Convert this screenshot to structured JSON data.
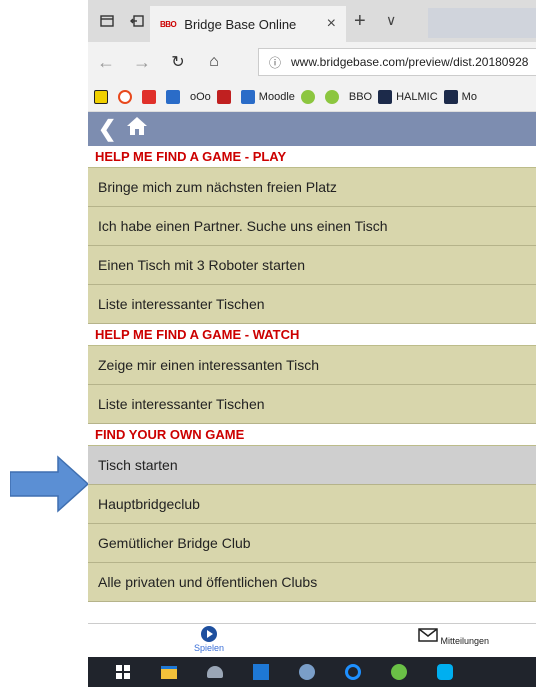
{
  "browser": {
    "tab_title": "Bridge Base Online",
    "tab_favicon": "BBO",
    "tab_close": "×",
    "new_tab": "+",
    "tab_menu": "∨",
    "url": "www.bridgebase.com/preview/dist.20180928",
    "nav_back": "←",
    "nav_forward": "→",
    "nav_refresh": "↻",
    "nav_home": "⌂",
    "url_info": "ⓘ"
  },
  "favorites": [
    {
      "label": "",
      "color": "#f0d000",
      "icon": "x-icon"
    },
    {
      "label": "",
      "color": "#e8491d",
      "icon": "app-icon"
    },
    {
      "label": "",
      "color": "#e0302a",
      "icon": "app-icon"
    },
    {
      "label": "",
      "color": "#2a6cc8",
      "icon": "app-icon"
    },
    {
      "label": "oOo",
      "color": "",
      "icon": ""
    },
    {
      "label": "",
      "color": "#c02020",
      "icon": "bmf-icon"
    },
    {
      "label": "Moodle",
      "color": "#2a6cc8",
      "icon": "moodle-icon"
    },
    {
      "label": "",
      "color": "#8cc63f",
      "icon": "circle-icon"
    },
    {
      "label": "",
      "color": "#8cc63f",
      "icon": "circle-icon"
    },
    {
      "label": "BBO",
      "color": "",
      "icon": "bbo-icon"
    },
    {
      "label": "HALMIC",
      "color": "#1c2a4a",
      "icon": "halmic-icon"
    },
    {
      "label": "Mo",
      "color": "#1c2a4a",
      "icon": "app-icon"
    }
  ],
  "page": {
    "back_label": "❮",
    "home_label": "🏠",
    "sections": [
      {
        "title": "HELP ME FIND A GAME - PLAY",
        "items": [
          "Bringe mich zum nächsten freien Platz",
          "Ich habe einen Partner. Suche uns einen Tisch",
          "Einen Tisch mit 3 Roboter starten",
          "Liste interessanter Tischen"
        ]
      },
      {
        "title": "HELP ME FIND A GAME - WATCH",
        "items": [
          "Zeige mir einen interessanten Tisch",
          "Liste interessanter Tischen"
        ]
      },
      {
        "title": "FIND YOUR OWN GAME",
        "items": [
          "Tisch starten",
          "Hauptbridgeclub",
          "Gemütlicher Bridge Club",
          "Alle privaten und öffentlichen Clubs"
        ]
      }
    ]
  },
  "bottom_nav": {
    "play_label": "Spielen",
    "messages_label": "Mitteilungen"
  },
  "colors": {
    "header_bg": "#7d8db0",
    "item_bg": "#d8d6ac",
    "selected_bg": "#cfcfcf",
    "section_text": "#cc0000",
    "arrow": "#5b8fd4"
  }
}
